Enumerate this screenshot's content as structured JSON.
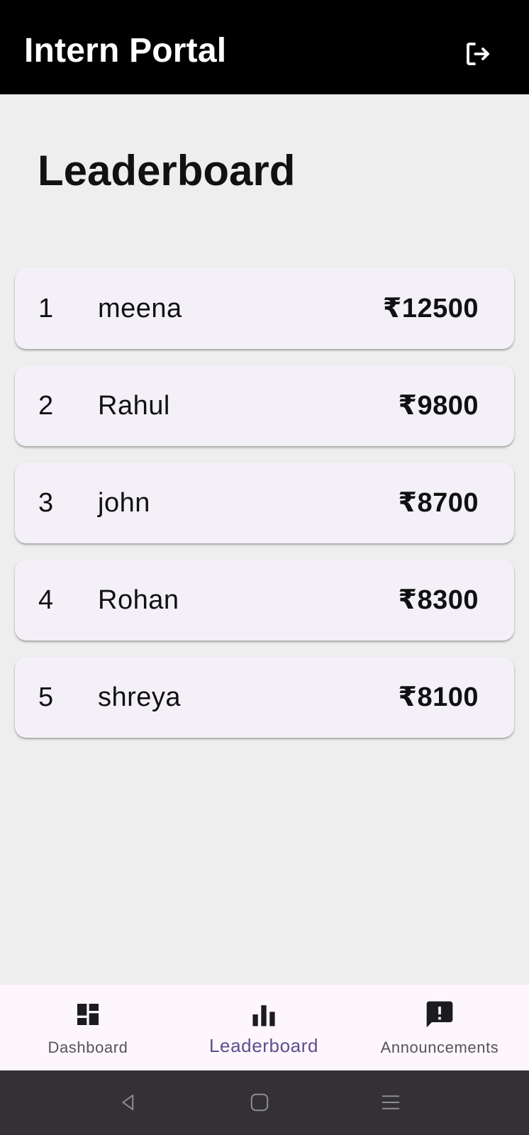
{
  "appbar": {
    "title": "Intern Portal",
    "logout_icon": "logout-icon"
  },
  "page": {
    "title": "Leaderboard"
  },
  "leaderboard": [
    {
      "rank": "1",
      "name": "meena",
      "amount": "₹12500"
    },
    {
      "rank": "2",
      "name": "Rahul",
      "amount": "₹9800"
    },
    {
      "rank": "3",
      "name": "john",
      "amount": "₹8700"
    },
    {
      "rank": "4",
      "name": "Rohan",
      "amount": "₹8300"
    },
    {
      "rank": "5",
      "name": "shreya",
      "amount": "₹8100"
    }
  ],
  "bottom_nav": {
    "items": [
      {
        "label": "Dashboard",
        "icon": "dashboard-icon",
        "active": false
      },
      {
        "label": "Leaderboard",
        "icon": "leaderboard-icon",
        "active": true
      },
      {
        "label": "Announcements",
        "icon": "announcement-icon",
        "active": false
      }
    ]
  },
  "system_nav": {
    "back_icon": "back-icon",
    "home_icon": "home-icon",
    "recents_icon": "recents-icon"
  },
  "colors": {
    "appbar_bg": "#000000",
    "page_bg": "#eeeeee",
    "card_bg": "#f4f0f7",
    "nav_bg": "#fdf7fd",
    "active_nav": "#5d4d8e",
    "system_nav_bg": "#333136"
  }
}
